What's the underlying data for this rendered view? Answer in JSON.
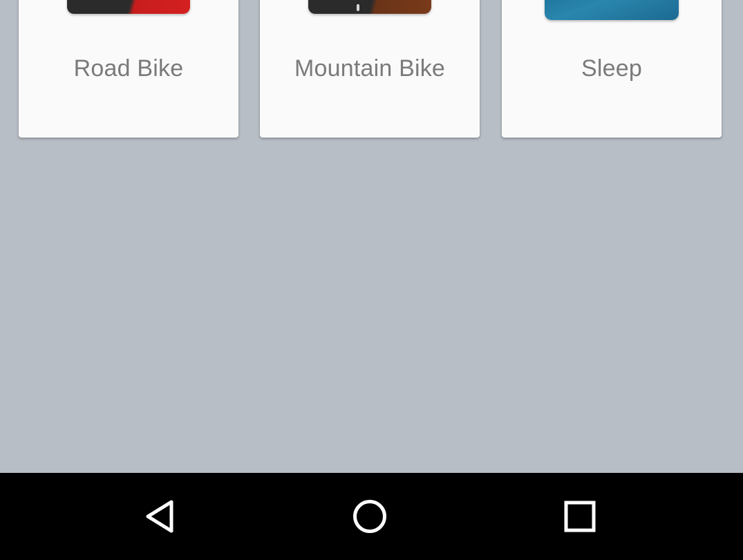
{
  "cards": [
    {
      "label": "Road Bike",
      "thumbnail_icon": "road-bike-image",
      "accent": "#d42020"
    },
    {
      "label": "Mountain Bike",
      "thumbnail_icon": "mountain-bike-image",
      "accent": "#7a3a1a"
    },
    {
      "label": "Sleep",
      "thumbnail_icon": "sleep-image",
      "accent": "#1c6a92"
    }
  ],
  "nav_bar": {
    "back_icon": "back-triangle-icon",
    "home_icon": "home-circle-icon",
    "recents_icon": "recents-square-icon"
  },
  "colors": {
    "background": "#b8bec6",
    "card": "#fafafa",
    "label_text": "#7a7a7a",
    "nav_bar": "#000000"
  }
}
